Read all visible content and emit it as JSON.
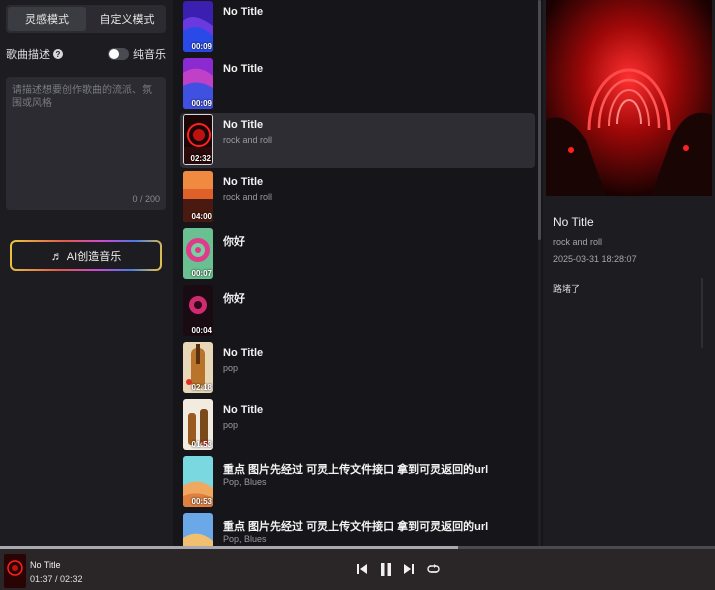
{
  "mode_tabs": {
    "inspiration": "灵感模式",
    "custom": "自定义模式"
  },
  "description": {
    "label": "歌曲描述",
    "toggle_label": "纯音乐",
    "toggle_on": false
  },
  "textarea": {
    "placeholder": "请描述想要创作歌曲的流派、氛围或风格",
    "counter": "0 / 200"
  },
  "ai_button": {
    "label": "AI创造音乐"
  },
  "songs": [
    {
      "title": "No Title",
      "tags": "",
      "duration": "00:09",
      "active": false
    },
    {
      "title": "No Title",
      "tags": "",
      "duration": "00:09",
      "active": false
    },
    {
      "title": "No Title",
      "tags": "rock and roll",
      "duration": "02:32",
      "active": true
    },
    {
      "title": "No Title",
      "tags": "rock and roll",
      "duration": "04:00",
      "active": false
    },
    {
      "title": "你好",
      "tags": "",
      "duration": "00:07",
      "active": false
    },
    {
      "title": "你好",
      "tags": "",
      "duration": "00:04",
      "active": false
    },
    {
      "title": "No Title",
      "tags": "pop",
      "duration": "02:18",
      "active": false
    },
    {
      "title": "No Title",
      "tags": "pop",
      "duration": "01:53",
      "active": false
    },
    {
      "title": "重点 图片先经过 可灵上传文件接口 拿到可灵返回的url",
      "tags": "Pop, Blues",
      "duration": "00:53",
      "active": false
    },
    {
      "title": "重点 图片先经过 可灵上传文件接口 拿到可灵返回的url",
      "tags": "Pop, Blues",
      "duration": "",
      "active": false
    }
  ],
  "detail": {
    "title": "No Title",
    "genre": "rock and roll",
    "date": "2025-03-31 18:28:07",
    "lyrics": "路堵了"
  },
  "player": {
    "title": "No Title",
    "time": "01:37 / 02:32",
    "progress": 0.64
  },
  "colors": {
    "accent_red": "#e0151a",
    "bg": "#16161a"
  }
}
